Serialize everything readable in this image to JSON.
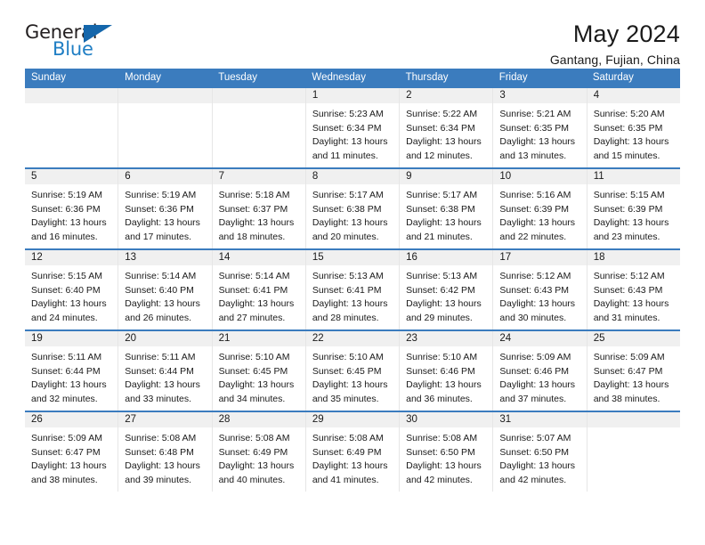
{
  "brand": {
    "name_part1": "General",
    "name_part2": "Blue",
    "triangle_icon": "blue-triangle-logo-mark"
  },
  "header": {
    "title": "May 2024",
    "subtitle": "Gantang, Fujian, China"
  },
  "colors": {
    "header_blue": "#3b7cbe",
    "logo_blue": "#1f7ec4",
    "logo_triangle": "#1466ab",
    "day_band_gray": "#f0f0f0",
    "cell_border": "#e6e6e6",
    "text": "#1a1a1a"
  },
  "calendar": {
    "weekdays": [
      "Sunday",
      "Monday",
      "Tuesday",
      "Wednesday",
      "Thursday",
      "Friday",
      "Saturday"
    ],
    "weeks": [
      [
        {
          "day": "",
          "sunrise": "",
          "sunset": "",
          "daylight_line1": "",
          "daylight_line2": "",
          "empty": true
        },
        {
          "day": "",
          "sunrise": "",
          "sunset": "",
          "daylight_line1": "",
          "daylight_line2": "",
          "empty": true
        },
        {
          "day": "",
          "sunrise": "",
          "sunset": "",
          "daylight_line1": "",
          "daylight_line2": "",
          "empty": true
        },
        {
          "day": "1",
          "sunrise": "Sunrise: 5:23 AM",
          "sunset": "Sunset: 6:34 PM",
          "daylight_line1": "Daylight: 13 hours",
          "daylight_line2": "and 11 minutes."
        },
        {
          "day": "2",
          "sunrise": "Sunrise: 5:22 AM",
          "sunset": "Sunset: 6:34 PM",
          "daylight_line1": "Daylight: 13 hours",
          "daylight_line2": "and 12 minutes."
        },
        {
          "day": "3",
          "sunrise": "Sunrise: 5:21 AM",
          "sunset": "Sunset: 6:35 PM",
          "daylight_line1": "Daylight: 13 hours",
          "daylight_line2": "and 13 minutes."
        },
        {
          "day": "4",
          "sunrise": "Sunrise: 5:20 AM",
          "sunset": "Sunset: 6:35 PM",
          "daylight_line1": "Daylight: 13 hours",
          "daylight_line2": "and 15 minutes."
        }
      ],
      [
        {
          "day": "5",
          "sunrise": "Sunrise: 5:19 AM",
          "sunset": "Sunset: 6:36 PM",
          "daylight_line1": "Daylight: 13 hours",
          "daylight_line2": "and 16 minutes."
        },
        {
          "day": "6",
          "sunrise": "Sunrise: 5:19 AM",
          "sunset": "Sunset: 6:36 PM",
          "daylight_line1": "Daylight: 13 hours",
          "daylight_line2": "and 17 minutes."
        },
        {
          "day": "7",
          "sunrise": "Sunrise: 5:18 AM",
          "sunset": "Sunset: 6:37 PM",
          "daylight_line1": "Daylight: 13 hours",
          "daylight_line2": "and 18 minutes."
        },
        {
          "day": "8",
          "sunrise": "Sunrise: 5:17 AM",
          "sunset": "Sunset: 6:38 PM",
          "daylight_line1": "Daylight: 13 hours",
          "daylight_line2": "and 20 minutes."
        },
        {
          "day": "9",
          "sunrise": "Sunrise: 5:17 AM",
          "sunset": "Sunset: 6:38 PM",
          "daylight_line1": "Daylight: 13 hours",
          "daylight_line2": "and 21 minutes."
        },
        {
          "day": "10",
          "sunrise": "Sunrise: 5:16 AM",
          "sunset": "Sunset: 6:39 PM",
          "daylight_line1": "Daylight: 13 hours",
          "daylight_line2": "and 22 minutes."
        },
        {
          "day": "11",
          "sunrise": "Sunrise: 5:15 AM",
          "sunset": "Sunset: 6:39 PM",
          "daylight_line1": "Daylight: 13 hours",
          "daylight_line2": "and 23 minutes."
        }
      ],
      [
        {
          "day": "12",
          "sunrise": "Sunrise: 5:15 AM",
          "sunset": "Sunset: 6:40 PM",
          "daylight_line1": "Daylight: 13 hours",
          "daylight_line2": "and 24 minutes."
        },
        {
          "day": "13",
          "sunrise": "Sunrise: 5:14 AM",
          "sunset": "Sunset: 6:40 PM",
          "daylight_line1": "Daylight: 13 hours",
          "daylight_line2": "and 26 minutes."
        },
        {
          "day": "14",
          "sunrise": "Sunrise: 5:14 AM",
          "sunset": "Sunset: 6:41 PM",
          "daylight_line1": "Daylight: 13 hours",
          "daylight_line2": "and 27 minutes."
        },
        {
          "day": "15",
          "sunrise": "Sunrise: 5:13 AM",
          "sunset": "Sunset: 6:41 PM",
          "daylight_line1": "Daylight: 13 hours",
          "daylight_line2": "and 28 minutes."
        },
        {
          "day": "16",
          "sunrise": "Sunrise: 5:13 AM",
          "sunset": "Sunset: 6:42 PM",
          "daylight_line1": "Daylight: 13 hours",
          "daylight_line2": "and 29 minutes."
        },
        {
          "day": "17",
          "sunrise": "Sunrise: 5:12 AM",
          "sunset": "Sunset: 6:43 PM",
          "daylight_line1": "Daylight: 13 hours",
          "daylight_line2": "and 30 minutes."
        },
        {
          "day": "18",
          "sunrise": "Sunrise: 5:12 AM",
          "sunset": "Sunset: 6:43 PM",
          "daylight_line1": "Daylight: 13 hours",
          "daylight_line2": "and 31 minutes."
        }
      ],
      [
        {
          "day": "19",
          "sunrise": "Sunrise: 5:11 AM",
          "sunset": "Sunset: 6:44 PM",
          "daylight_line1": "Daylight: 13 hours",
          "daylight_line2": "and 32 minutes."
        },
        {
          "day": "20",
          "sunrise": "Sunrise: 5:11 AM",
          "sunset": "Sunset: 6:44 PM",
          "daylight_line1": "Daylight: 13 hours",
          "daylight_line2": "and 33 minutes."
        },
        {
          "day": "21",
          "sunrise": "Sunrise: 5:10 AM",
          "sunset": "Sunset: 6:45 PM",
          "daylight_line1": "Daylight: 13 hours",
          "daylight_line2": "and 34 minutes."
        },
        {
          "day": "22",
          "sunrise": "Sunrise: 5:10 AM",
          "sunset": "Sunset: 6:45 PM",
          "daylight_line1": "Daylight: 13 hours",
          "daylight_line2": "and 35 minutes."
        },
        {
          "day": "23",
          "sunrise": "Sunrise: 5:10 AM",
          "sunset": "Sunset: 6:46 PM",
          "daylight_line1": "Daylight: 13 hours",
          "daylight_line2": "and 36 minutes."
        },
        {
          "day": "24",
          "sunrise": "Sunrise: 5:09 AM",
          "sunset": "Sunset: 6:46 PM",
          "daylight_line1": "Daylight: 13 hours",
          "daylight_line2": "and 37 minutes."
        },
        {
          "day": "25",
          "sunrise": "Sunrise: 5:09 AM",
          "sunset": "Sunset: 6:47 PM",
          "daylight_line1": "Daylight: 13 hours",
          "daylight_line2": "and 38 minutes."
        }
      ],
      [
        {
          "day": "26",
          "sunrise": "Sunrise: 5:09 AM",
          "sunset": "Sunset: 6:47 PM",
          "daylight_line1": "Daylight: 13 hours",
          "daylight_line2": "and 38 minutes."
        },
        {
          "day": "27",
          "sunrise": "Sunrise: 5:08 AM",
          "sunset": "Sunset: 6:48 PM",
          "daylight_line1": "Daylight: 13 hours",
          "daylight_line2": "and 39 minutes."
        },
        {
          "day": "28",
          "sunrise": "Sunrise: 5:08 AM",
          "sunset": "Sunset: 6:49 PM",
          "daylight_line1": "Daylight: 13 hours",
          "daylight_line2": "and 40 minutes."
        },
        {
          "day": "29",
          "sunrise": "Sunrise: 5:08 AM",
          "sunset": "Sunset: 6:49 PM",
          "daylight_line1": "Daylight: 13 hours",
          "daylight_line2": "and 41 minutes."
        },
        {
          "day": "30",
          "sunrise": "Sunrise: 5:08 AM",
          "sunset": "Sunset: 6:50 PM",
          "daylight_line1": "Daylight: 13 hours",
          "daylight_line2": "and 42 minutes."
        },
        {
          "day": "31",
          "sunrise": "Sunrise: 5:07 AM",
          "sunset": "Sunset: 6:50 PM",
          "daylight_line1": "Daylight: 13 hours",
          "daylight_line2": "and 42 minutes."
        },
        {
          "day": "",
          "sunrise": "",
          "sunset": "",
          "daylight_line1": "",
          "daylight_line2": "",
          "empty": true
        }
      ]
    ]
  }
}
